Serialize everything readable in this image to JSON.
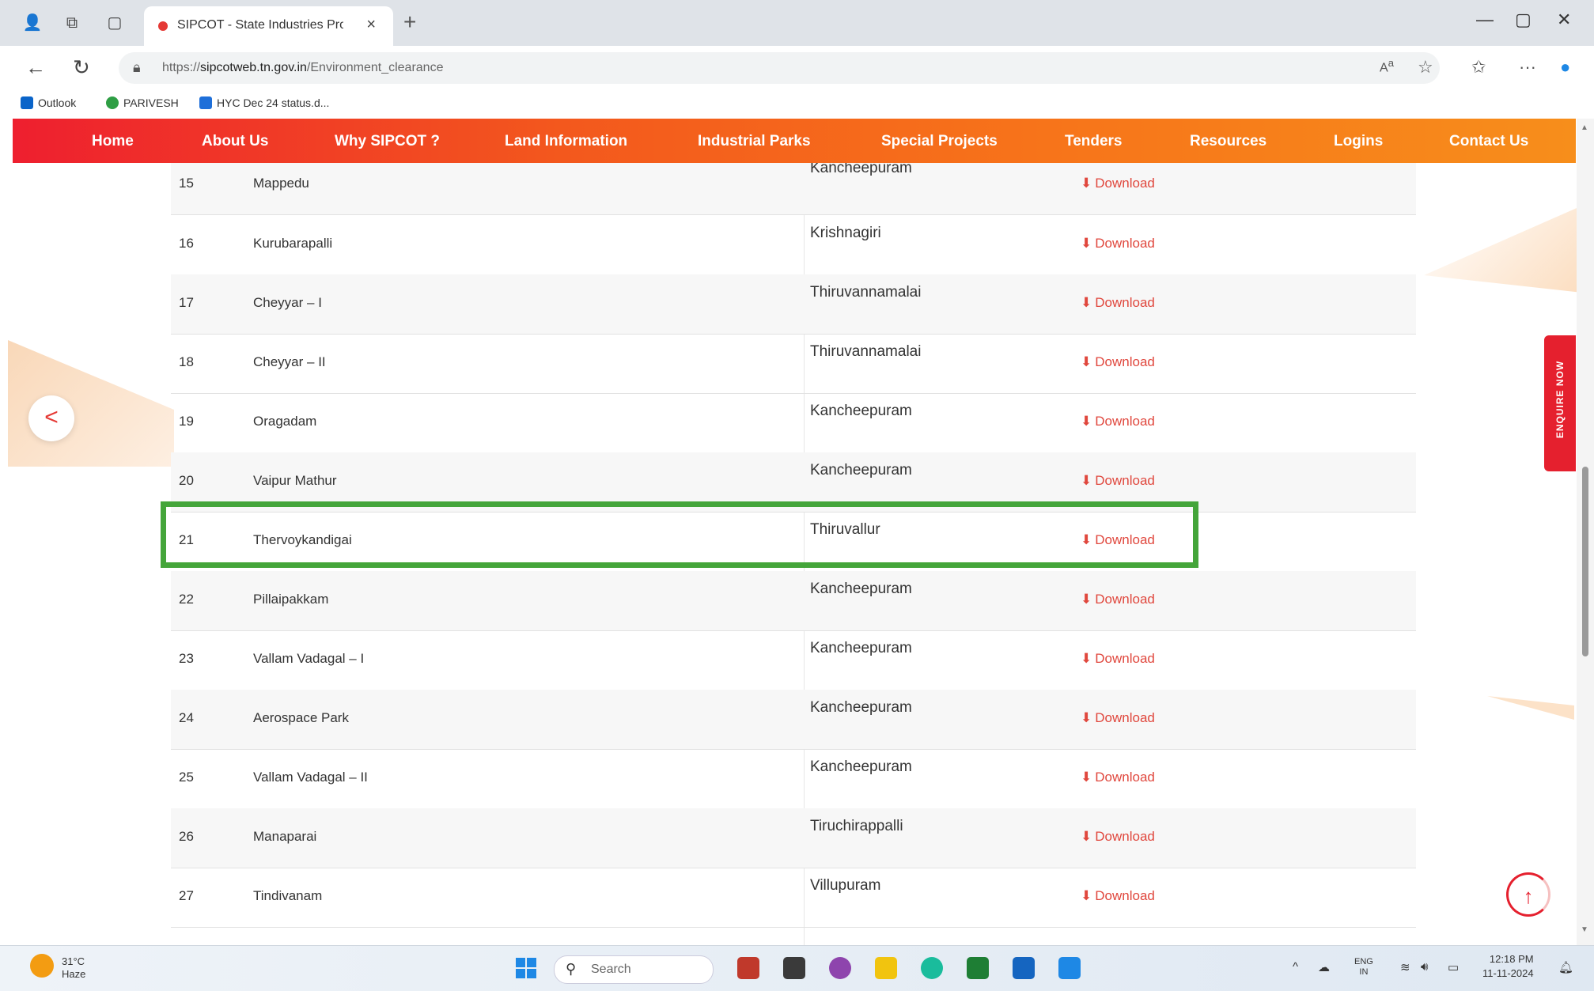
{
  "browser": {
    "tab_title": "SIPCOT - State Industries Promot",
    "url_prefix": "https://",
    "url_host": "sipcotweb.tn.gov.in",
    "url_path": "/Environment_clearance",
    "bookmarks": [
      "Outlook",
      "PARIVESH",
      "HYC Dec 24 status.d..."
    ]
  },
  "nav": {
    "items": [
      "Home",
      "About Us",
      "Why SIPCOT ?",
      "Land Information",
      "Industrial Parks",
      "Special Projects",
      "Tenders",
      "Resources",
      "Logins",
      "Contact Us"
    ]
  },
  "side": {
    "enquire_label": "ENQUIRE NOW"
  },
  "table": {
    "download_label": "Download",
    "rows": [
      {
        "num": "15",
        "name": "Mappedu",
        "district": "Kancheepuram"
      },
      {
        "num": "16",
        "name": "Kurubarapalli",
        "district": "Krishnagiri"
      },
      {
        "num": "17",
        "name": "Cheyyar – I",
        "district": "Thiruvannamalai"
      },
      {
        "num": "18",
        "name": "Cheyyar – II",
        "district": "Thiruvannamalai"
      },
      {
        "num": "19",
        "name": "Oragadam",
        "district": "Kancheepuram"
      },
      {
        "num": "20",
        "name": "Vaipur Mathur",
        "district": "Kancheepuram"
      },
      {
        "num": "21",
        "name": "Thervoykandigai",
        "district": "Thiruvallur"
      },
      {
        "num": "22",
        "name": "Pillaipakkam",
        "district": "Kancheepuram"
      },
      {
        "num": "23",
        "name": "Vallam Vadagal – I",
        "district": "Kancheepuram"
      },
      {
        "num": "24",
        "name": "Aerospace Park",
        "district": "Kancheepuram"
      },
      {
        "num": "25",
        "name": "Vallam Vadagal – II",
        "district": "Kancheepuram"
      },
      {
        "num": "26",
        "name": "Manaparai",
        "district": "Tiruchirappalli"
      },
      {
        "num": "27",
        "name": "Tindivanam",
        "district": "Villupuram"
      }
    ]
  },
  "taskbar": {
    "temp": "31°C",
    "weather": "Haze",
    "search_placeholder": "Search",
    "lang_top": "ENG",
    "lang_bottom": "IN",
    "time": "12:18 PM",
    "date": "11-11-2024"
  },
  "colors": {
    "nav_start": "#ee1f2f",
    "nav_end": "#f78e1b",
    "download": "#e0473d",
    "highlight": "#44a53a"
  }
}
